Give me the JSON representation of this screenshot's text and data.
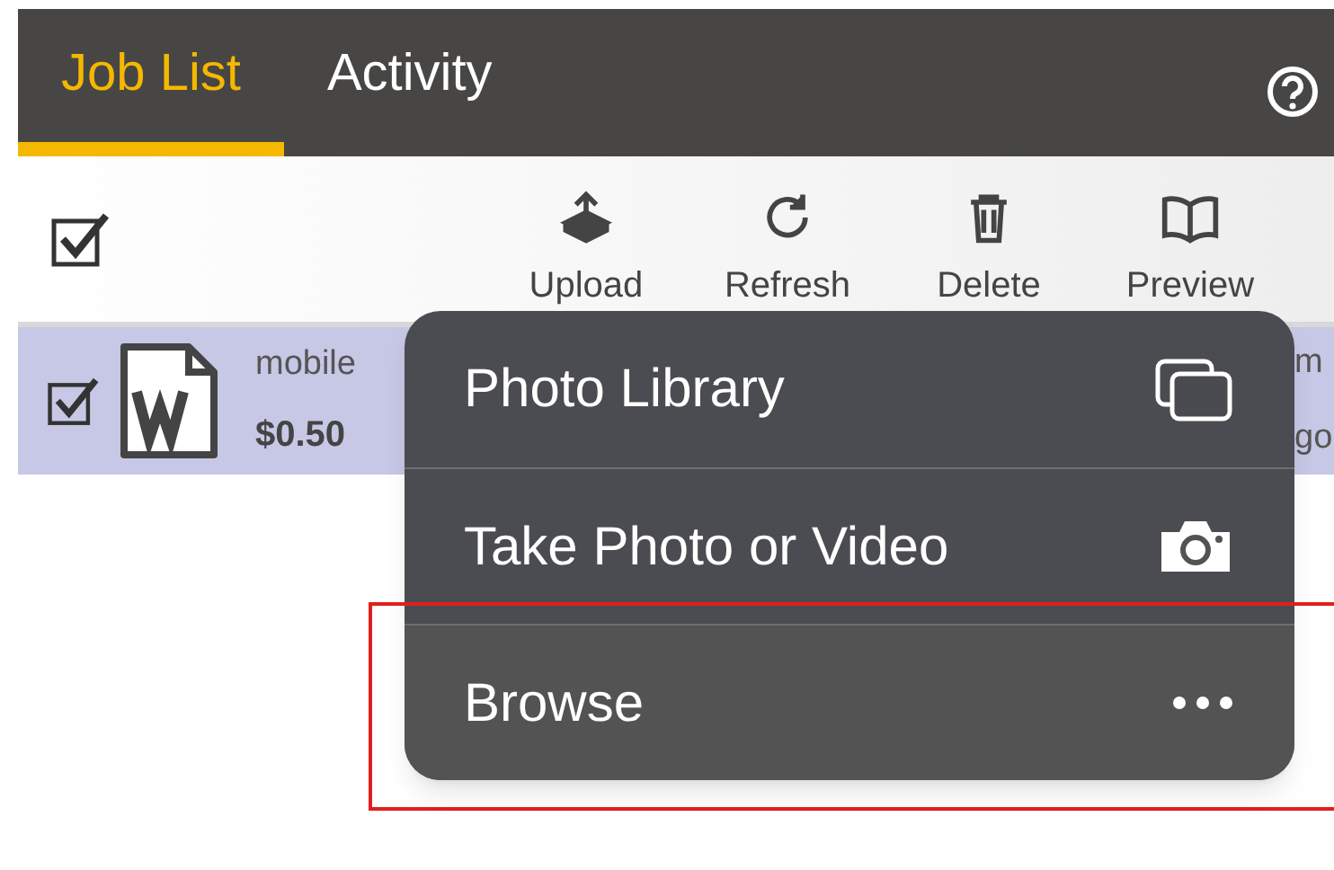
{
  "tabs": [
    {
      "label": "Job List",
      "selected": true
    },
    {
      "label": "Activity",
      "selected": false
    }
  ],
  "toolbar": {
    "select_all_checked": true,
    "actions": [
      {
        "kind": "upload",
        "label": "Upload"
      },
      {
        "kind": "refresh",
        "label": "Refresh"
      },
      {
        "kind": "delete",
        "label": "Delete"
      },
      {
        "kind": "preview",
        "label": "Preview"
      }
    ]
  },
  "jobs": [
    {
      "checked": true,
      "selected": true,
      "name": "mobile",
      "price": "$0.50",
      "column_3": "m",
      "column_4": "go"
    }
  ],
  "menu": {
    "items": [
      {
        "kind": "library",
        "label": "Photo Library"
      },
      {
        "kind": "camera",
        "label": "Take Photo or Video"
      },
      {
        "kind": "more",
        "label": "Browse",
        "highlighted": true
      }
    ]
  }
}
